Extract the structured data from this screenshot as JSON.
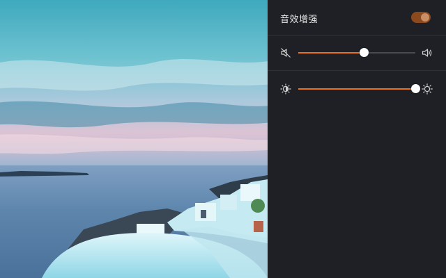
{
  "panel": {
    "sound_enhance": {
      "label": "音效增强",
      "enabled": true
    },
    "volume": {
      "level_percent": 56,
      "min_icon": "mute-speaker-icon",
      "max_icon": "speaker-loud-icon"
    },
    "brightness": {
      "level_percent": 100,
      "min_icon": "brightness-low-icon",
      "max_icon": "brightness-high-icon"
    }
  },
  "colors": {
    "accent": "#e8731c",
    "panel_bg": "#1f2025",
    "toggle_on": "#8a4a1e"
  }
}
